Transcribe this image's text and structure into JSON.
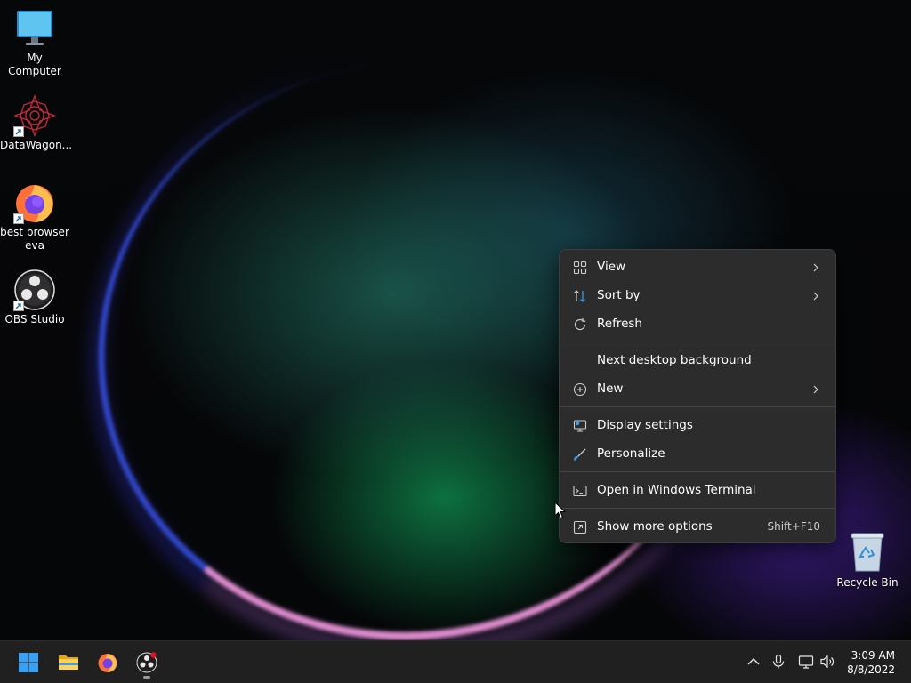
{
  "desktop": {
    "icons": [
      {
        "label": "My Computer",
        "icon": "monitor-icon"
      },
      {
        "label": "DataWagon...",
        "icon": "datawagon-icon"
      },
      {
        "label": "best browser eva",
        "icon": "firefox-icon"
      },
      {
        "label": "OBS Studio",
        "icon": "obs-icon"
      }
    ],
    "recycle_bin": {
      "label": "Recycle Bin",
      "icon": "recycle-bin-icon"
    }
  },
  "context_menu": {
    "items": [
      {
        "label": "View",
        "icon": "view-grid-icon",
        "submenu": true
      },
      {
        "label": "Sort by",
        "icon": "sort-icon",
        "submenu": true
      },
      {
        "label": "Refresh",
        "icon": "refresh-icon",
        "submenu": false
      },
      {
        "label": "Next desktop background",
        "icon": "",
        "submenu": false
      },
      {
        "label": "New",
        "icon": "new-plus-icon",
        "submenu": true
      },
      {
        "label": "Display settings",
        "icon": "display-settings-icon",
        "submenu": false
      },
      {
        "label": "Personalize",
        "icon": "brush-icon",
        "submenu": false
      },
      {
        "label": "Open in Windows Terminal",
        "icon": "terminal-icon",
        "submenu": false
      },
      {
        "label": "Show more options",
        "icon": "more-options-icon",
        "submenu": false,
        "shortcut": "Shift+F10"
      }
    ]
  },
  "taskbar": {
    "apps": [
      {
        "name": "Start",
        "icon": "windows-start-icon"
      },
      {
        "name": "File Explorer",
        "icon": "folder-icon"
      },
      {
        "name": "Firefox",
        "icon": "firefox-icon"
      },
      {
        "name": "OBS Studio",
        "icon": "obs-icon",
        "recording": true
      }
    ],
    "tray": [
      "chevron-up-icon",
      "microphone-icon",
      "network-icon",
      "volume-icon"
    ],
    "clock": {
      "time": "3:09 AM",
      "date": "8/8/2022"
    }
  },
  "colors": {
    "menu_bg": "#2c2c2c",
    "taskbar_bg": "#202020",
    "accent_blue": "#3aa0f3",
    "record_red": "#e81123"
  }
}
